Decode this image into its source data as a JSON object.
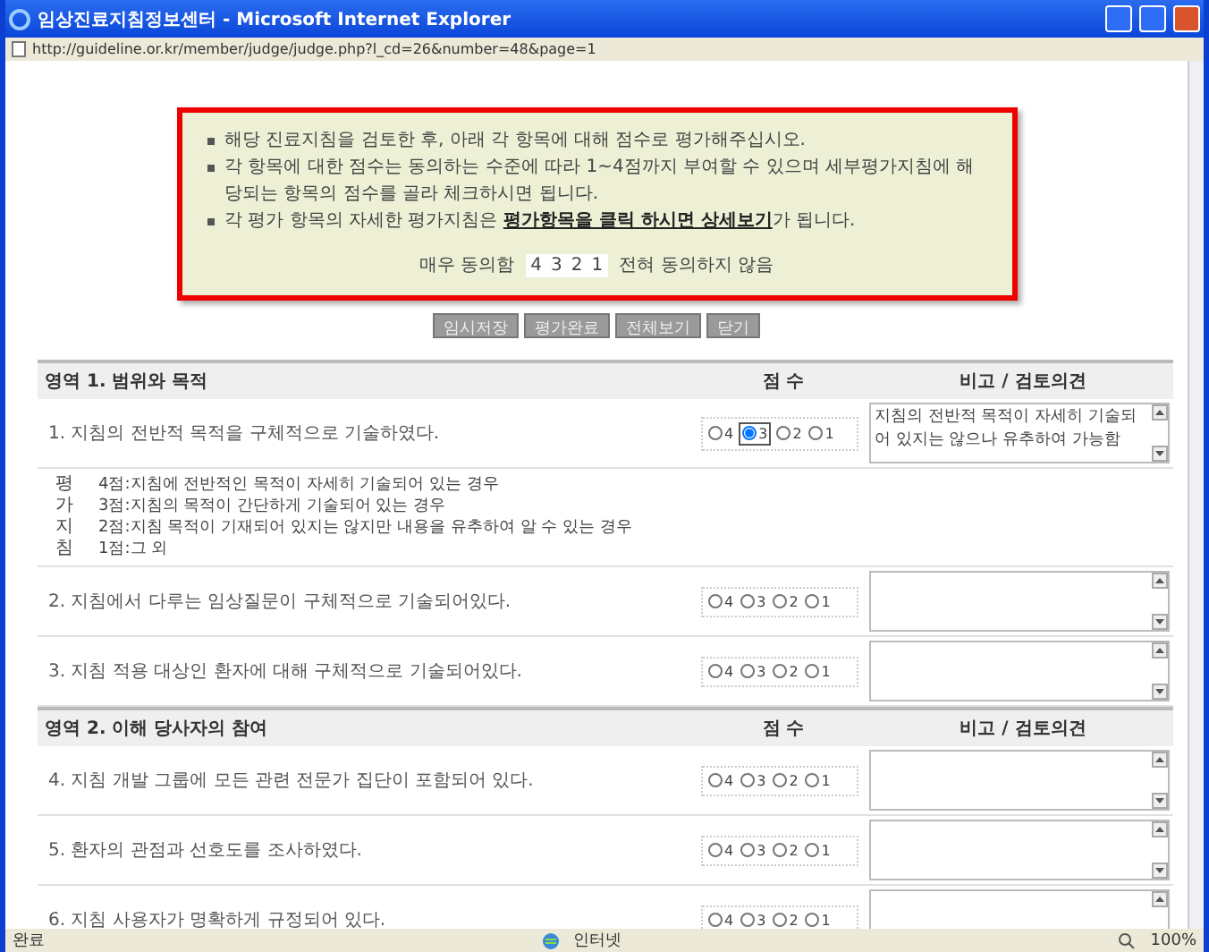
{
  "window": {
    "title": "임상진료지침정보센터 - Microsoft Internet Explorer",
    "address": "http://guideline.or.kr/member/judge/judge.php?l_cd=26&number=48&page=1"
  },
  "notice": {
    "bullets": [
      "해당 진료지침을 검토한 후, 아래 각 항목에 대해 점수로 평가해주십시오.",
      "각 항목에 대한 점수는 동의하는 수준에 따라 1~4점까지 부여할 수 있으며 세부평가지침에 해당되는 항목의 점수를 골라 체크하시면 됩니다.",
      "각 평가 항목의 자세한 평가지침은 **평가항목을 클릭 하시면 상세보기**가 됩니다."
    ],
    "scale": {
      "high_label": "매우 동의함",
      "values": [
        "4",
        "3",
        "2",
        "1"
      ],
      "low_label": "전혀 동의하지 않음"
    }
  },
  "buttons": [
    "임시저장",
    "평가완료",
    "전체보기",
    "닫기"
  ],
  "sections": [
    {
      "title": "영역 1. 범위와 목적",
      "score_header": "점 수",
      "comment_header": "비고 / 검토의견",
      "items": [
        {
          "text": "1. 지침의 전반적 목적을 구체적으로 기술하였다.",
          "options": [
            {
              "label": "4",
              "selected": false
            },
            {
              "label": "3",
              "selected": true
            },
            {
              "label": "2",
              "selected": false
            },
            {
              "label": "1",
              "selected": false
            }
          ],
          "comment": "지침의 전반적 목적이 자세히 기술되어 있지는 않으나 유추하여 가능함",
          "guide": {
            "label": "평가지침",
            "lines": [
              "4점:지침에 전반적인 목적이 자세히 기술되어 있는 경우",
              "3점:지침의 목적이 간단하게 기술되어 있는 경우",
              "2점:지침 목적이 기재되어 있지는 않지만 내용을 유추하여 알 수 있는 경우",
              "1점:그 외"
            ]
          }
        },
        {
          "text": "2. 지침에서 다루는 임상질문이 구체적으로 기술되어있다.",
          "options": [
            {
              "label": "4",
              "selected": false
            },
            {
              "label": "3",
              "selected": false
            },
            {
              "label": "2",
              "selected": false
            },
            {
              "label": "1",
              "selected": false
            }
          ]
        },
        {
          "text": "3. 지침 적용 대상인 환자에 대해 구체적으로 기술되어있다.",
          "options": [
            {
              "label": "4",
              "selected": false
            },
            {
              "label": "3",
              "selected": false
            },
            {
              "label": "2",
              "selected": false
            },
            {
              "label": "1",
              "selected": false
            }
          ]
        }
      ]
    },
    {
      "title": "영역 2. 이해 당사자의 참여",
      "score_header": "점 수",
      "comment_header": "비고 / 검토의견",
      "items": [
        {
          "text": "4. 지침 개발 그룹에 모든 관련 전문가 집단이 포함되어 있다.",
          "options": [
            {
              "label": "4",
              "selected": false
            },
            {
              "label": "3",
              "selected": false
            },
            {
              "label": "2",
              "selected": false
            },
            {
              "label": "1",
              "selected": false
            }
          ]
        },
        {
          "text": "5. 환자의 관점과 선호도를 조사하였다.",
          "options": [
            {
              "label": "4",
              "selected": false
            },
            {
              "label": "3",
              "selected": false
            },
            {
              "label": "2",
              "selected": false
            },
            {
              "label": "1",
              "selected": false
            }
          ]
        },
        {
          "text": "6. 지침 사용자가 명확하게 규정되어 있다.",
          "options": [
            {
              "label": "4",
              "selected": false
            },
            {
              "label": "3",
              "selected": false
            },
            {
              "label": "2",
              "selected": false
            },
            {
              "label": "1",
              "selected": false
            }
          ]
        }
      ]
    }
  ],
  "status_bar": {
    "status": "완료",
    "zone": "인터넷",
    "zoom": "100%"
  }
}
